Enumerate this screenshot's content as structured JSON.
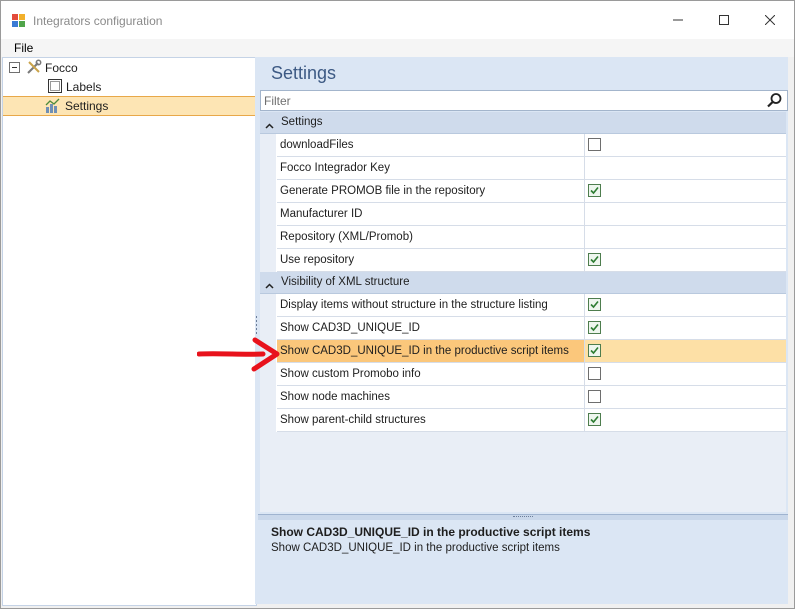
{
  "window": {
    "title": "Integrators configuration",
    "buttons": [
      "minimize-icon",
      "maximize-icon",
      "close-icon"
    ]
  },
  "menu": {
    "items": [
      "File"
    ]
  },
  "tree": {
    "root": {
      "label": "Focco",
      "icon": "tools-icon",
      "expanded": true
    },
    "children": [
      {
        "label": "Labels",
        "icon": "labels-icon",
        "selected": false
      },
      {
        "label": "Settings",
        "icon": "settings-chart-icon",
        "selected": true
      }
    ]
  },
  "panel": {
    "title": "Settings",
    "filter_placeholder": "Filter",
    "categories": [
      {
        "label": "Settings",
        "expanded": true,
        "properties": [
          {
            "name": "downloadFiles",
            "type": "checkbox",
            "checked": false
          },
          {
            "name": "Focco Integrador Key",
            "type": "text",
            "value": ""
          },
          {
            "name": "Generate PROMOB file in the repository",
            "type": "checkbox",
            "checked": true
          },
          {
            "name": "Manufacturer ID",
            "type": "text",
            "value": ""
          },
          {
            "name": "Repository (XML/Promob)",
            "type": "text",
            "value": ""
          },
          {
            "name": "Use repository",
            "type": "checkbox",
            "checked": true
          }
        ]
      },
      {
        "label": "Visibility of XML structure",
        "expanded": true,
        "properties": [
          {
            "name": "Display items without structure in the structure listing",
            "type": "checkbox",
            "checked": true
          },
          {
            "name": "Show CAD3D_UNIQUE_ID",
            "type": "checkbox",
            "checked": true
          },
          {
            "name": "Show CAD3D_UNIQUE_ID in the productive script items",
            "type": "checkbox",
            "checked": true,
            "selected": true
          },
          {
            "name": "Show custom Promobo info",
            "type": "checkbox",
            "checked": false
          },
          {
            "name": "Show node machines",
            "type": "checkbox",
            "checked": false
          },
          {
            "name": "Show parent-child structures",
            "type": "checkbox",
            "checked": true
          }
        ]
      }
    ],
    "help": {
      "title": "Show CAD3D_UNIQUE_ID in the productive script items",
      "description": "Show CAD3D_UNIQUE_ID in the productive script items"
    }
  },
  "colors": {
    "accent_blue": "#3d5a84",
    "selection": "#fbc77b",
    "annotation_arrow": "#e8121c"
  }
}
